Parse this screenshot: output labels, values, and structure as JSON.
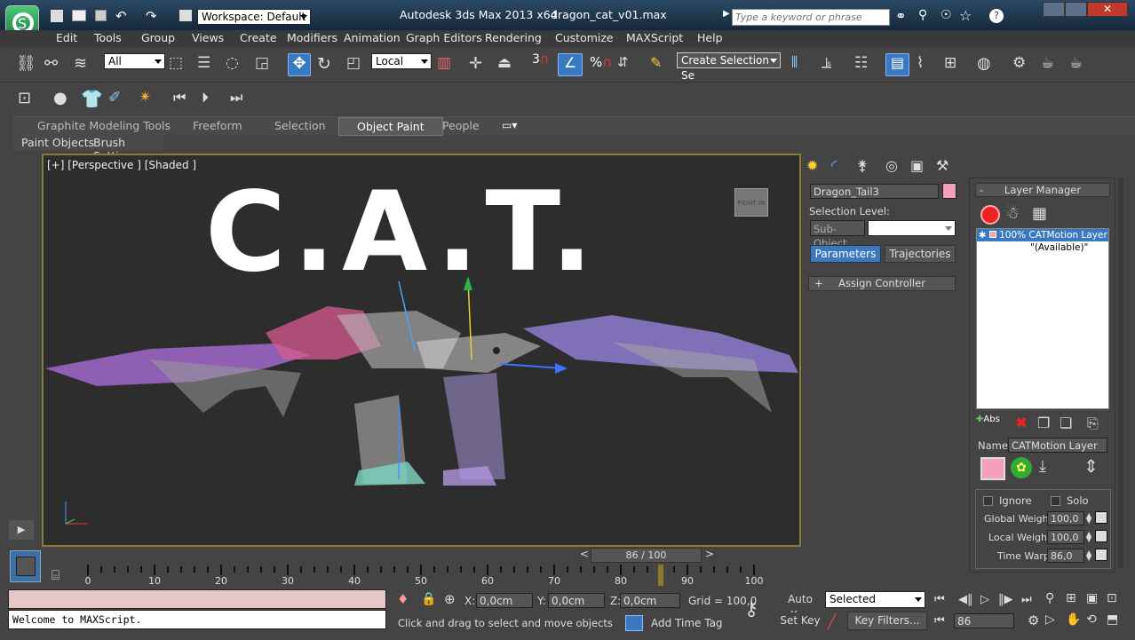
{
  "title": {
    "app": "Autodesk 3ds Max  2013 x64",
    "file": "dragon_cat_v01.max",
    "workspace": "Workspace: Default",
    "search_placeholder": "Type a keyword or phrase"
  },
  "menu": [
    "Edit",
    "Tools",
    "Group",
    "Views",
    "Create",
    "Modifiers",
    "Animation",
    "Graph Editors",
    "Rendering",
    "Customize",
    "MAXScript",
    "Help"
  ],
  "toolbar": {
    "filter": "All",
    "coord_system": "Local",
    "selection_set": "Create Selection Se",
    "snap_label": "3"
  },
  "ribbon": {
    "tabs": [
      "Graphite Modeling Tools",
      "Freeform",
      "Selection",
      "Object Paint",
      "People"
    ],
    "active": "Object Paint",
    "sub": [
      "Paint Objects",
      "Brush Settings"
    ]
  },
  "viewport": {
    "label": "[+] [Perspective ] [Shaded ]",
    "overlay_text": "C.A.T.",
    "sign_text": "FIGHT IN"
  },
  "command_panel": {
    "object_name": "Dragon_Tail3",
    "object_color": "#f4a0b8",
    "selection_level": "Selection Level:",
    "sub_object": "Sub-Object",
    "tabs": [
      "Parameters",
      "Trajectories"
    ],
    "rollout": "Assign Controller",
    "rollout_sign": "+"
  },
  "layer_manager": {
    "title": "Layer Manager",
    "minus": "-",
    "layers": [
      "100% CATMotion Layer",
      "\"(Available)\""
    ],
    "abs_label": "Abs",
    "name_label": "Name:",
    "name_value": "CATMotion Layer",
    "layer_color": "#f4a0b8",
    "ignore": "Ignore",
    "solo": "Solo",
    "global_weight_label": "Global Weight:",
    "global_weight": "100,0",
    "local_weight_label": "Local Weight:",
    "local_weight": "100,0",
    "time_warp_label": "Time Warp:",
    "time_warp": "86,0"
  },
  "timeline": {
    "frame": "86 / 100",
    "ticks": [
      "0",
      "10",
      "20",
      "30",
      "40",
      "50",
      "60",
      "70",
      "80",
      "90",
      "100"
    ],
    "current": 86
  },
  "status": {
    "maxscript": "Welcome to MAXScript.",
    "x_label": "X:",
    "x": "0,0cm",
    "y_label": "Y:",
    "y": "0,0cm",
    "z_label": "Z:",
    "z": "0,0cm",
    "grid": "Grid = 100,0",
    "prompt": "Click and drag to select and move objects",
    "add_time_tag": "Add Time Tag",
    "auto_key": "Auto Key",
    "set_key": "Set Key",
    "key_mode": "Selected",
    "key_filters": "Key Filters...",
    "frame_field": "86"
  }
}
